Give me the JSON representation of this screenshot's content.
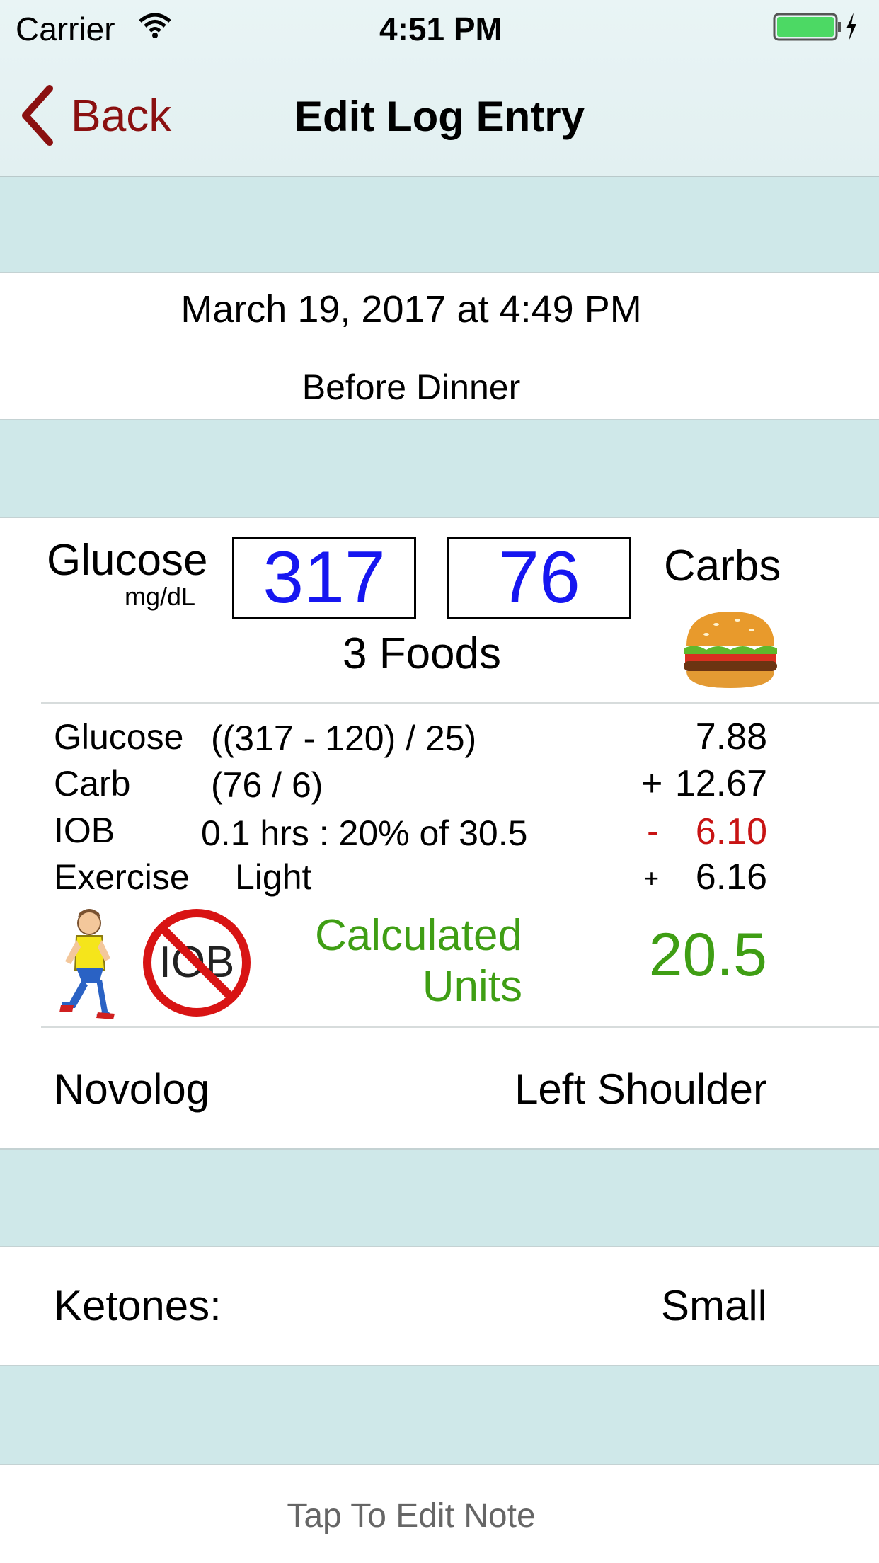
{
  "status_bar": {
    "carrier": "Carrier",
    "time": "4:51 PM",
    "battery_color": "#4cd964"
  },
  "nav": {
    "back_label": "Back",
    "title": "Edit Log Entry",
    "accent_color": "#8a1010"
  },
  "entry": {
    "datetime": "March 19, 2017 at 4:49 PM",
    "meal": "Before Dinner"
  },
  "measurements": {
    "glucose_label": "Glucose",
    "glucose_unit": "mg/dL",
    "glucose_value": "317",
    "carbs_value": "76",
    "carbs_label": "Carbs",
    "foods_label": "3 Foods",
    "food_icon": "hamburger-icon",
    "value_color": "#1616f0"
  },
  "calculation": {
    "rows": [
      {
        "label": "Glucose",
        "formula": "((317 - 120) / 25)",
        "sign": "",
        "value": "7.88"
      },
      {
        "label": "Carb",
        "formula": "(76 / 6)",
        "sign": "+",
        "value": "12.67"
      },
      {
        "label": "IOB",
        "formula": "0.1 hrs : 20% of 30.5",
        "sign": "-",
        "value": "6.10"
      },
      {
        "label": "Exercise",
        "formula": "Light",
        "sign": "+",
        "value": "6.16"
      }
    ],
    "iob_icon_text": "IOB",
    "calculated_label_line1": "Calculated",
    "calculated_label_line2": "Units",
    "calculated_value": "20.5",
    "calculated_color": "#3f9e14",
    "negative_color": "#c81414"
  },
  "insulin": {
    "type": "Novolog",
    "site": "Left Shoulder"
  },
  "ketones": {
    "label": "Ketones:",
    "value": "Small"
  },
  "note": {
    "placeholder": "Tap To Edit Note"
  }
}
